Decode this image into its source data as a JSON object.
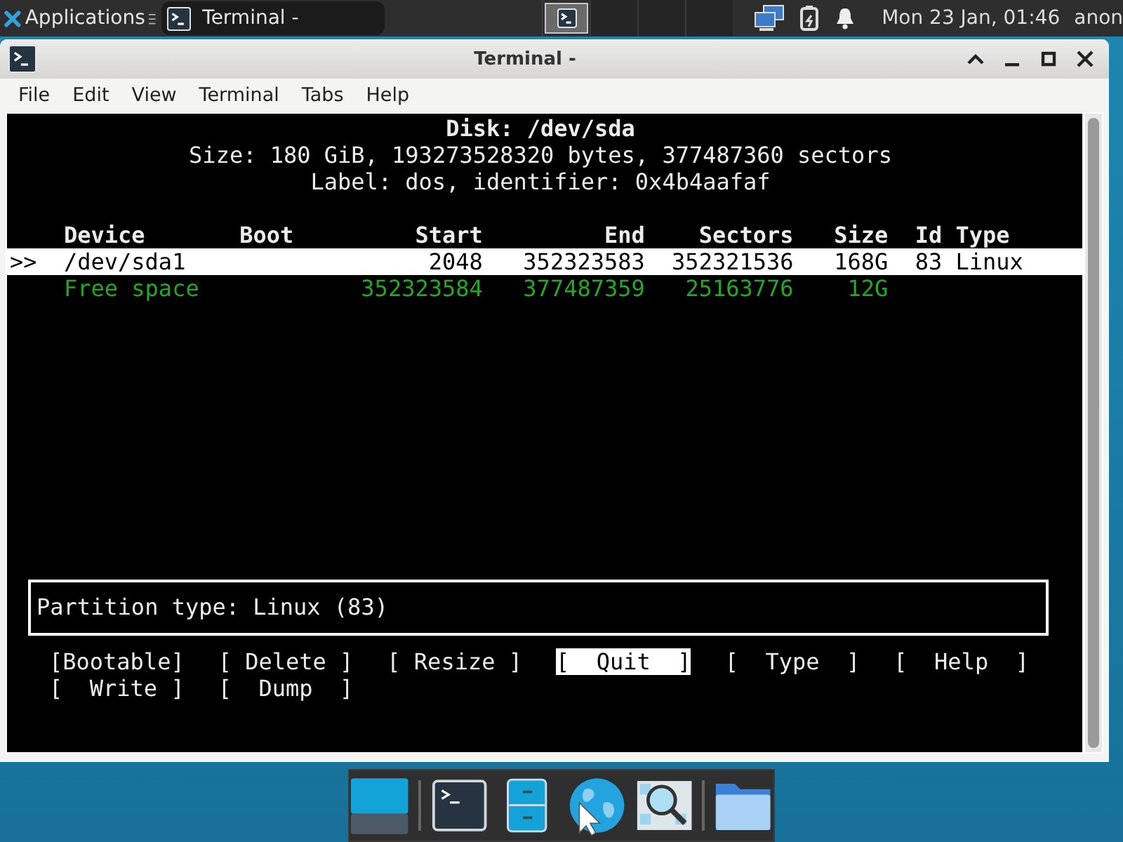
{
  "top_panel": {
    "applications_label": "Applications",
    "tasks": [
      {
        "title": "Terminal -"
      }
    ],
    "workspaces": [
      {
        "selected": true
      },
      {
        "selected": false
      },
      {
        "selected": false
      },
      {
        "selected": false
      }
    ],
    "clock": "Mon 23 Jan, 01:46",
    "user": "anon"
  },
  "window": {
    "title": "Terminal -",
    "menu": [
      "File",
      "Edit",
      "View",
      "Terminal",
      "Tabs",
      "Help"
    ]
  },
  "terminal": {
    "disk_title": "Disk: /dev/sda",
    "disk_size": "Size: 180 GiB, 193273528320 bytes, 377487360 sectors",
    "disk_label": "Label: dos, identifier: 0x4b4aafaf",
    "columns": [
      "Device",
      "Boot",
      "Start",
      "End",
      "Sectors",
      "Size",
      "Id",
      "Type"
    ],
    "rows": [
      {
        "kind": "partition",
        "selected": true,
        "marker": ">>",
        "device": "/dev/sda1",
        "start": "2048",
        "end": "352323583",
        "sectors": "352321536",
        "size": "168G",
        "id": "83",
        "type": "Linux"
      },
      {
        "kind": "free",
        "selected": false,
        "device": "Free space",
        "start": "352323584",
        "end": "377487359",
        "sectors": "25163776",
        "size": "12G"
      }
    ],
    "info": "Partition type: Linux (83)",
    "buttons": [
      {
        "label": "[Bootable]",
        "selected": false
      },
      {
        "label": "[ Delete ]",
        "selected": false
      },
      {
        "label": "[ Resize ]",
        "selected": false
      },
      {
        "label": "[  Quit  ]",
        "selected": true
      },
      {
        "label": "[  Type  ]",
        "selected": false
      },
      {
        "label": "[  Help  ]",
        "selected": false
      },
      {
        "label": "[  Write ]",
        "selected": false
      },
      {
        "label": "[  Dump  ]",
        "selected": false
      }
    ]
  }
}
